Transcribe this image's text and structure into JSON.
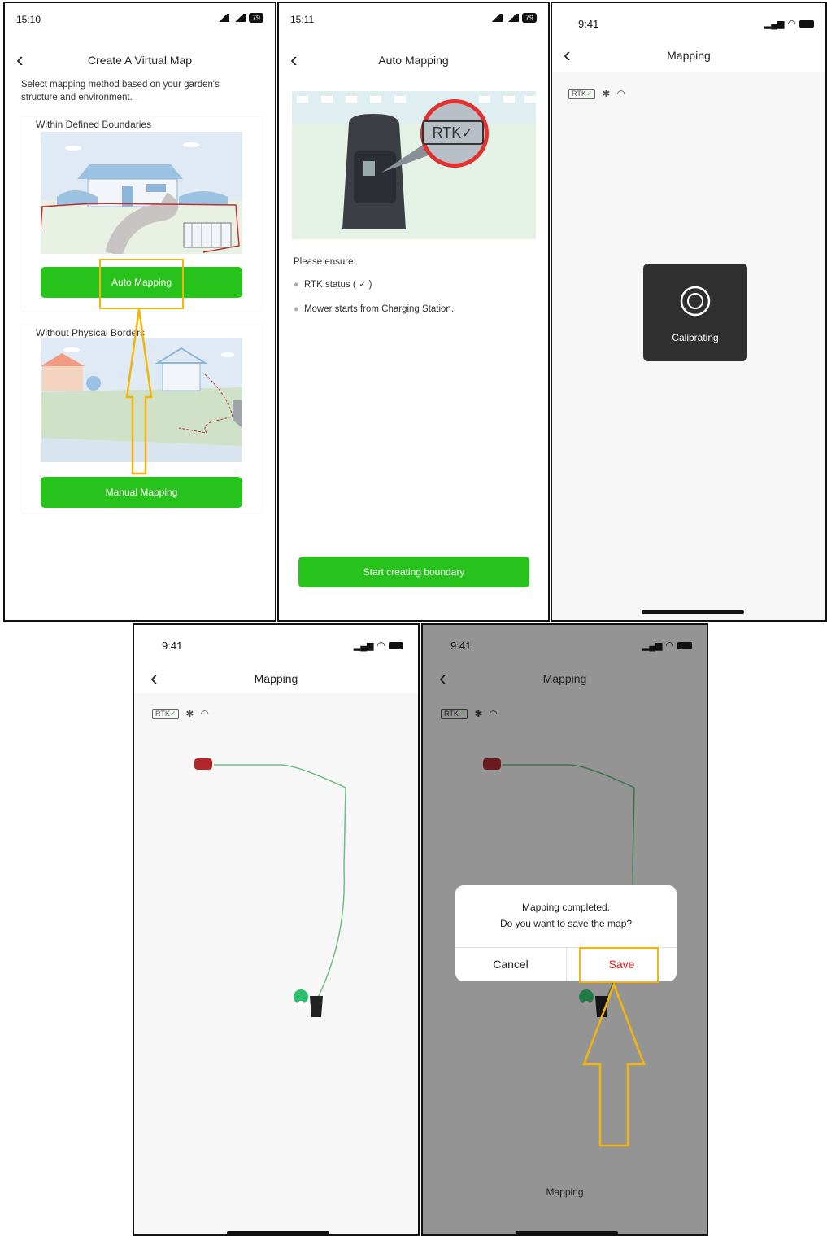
{
  "screen1": {
    "time": "15:10",
    "battery": "79",
    "title": "Create A Virtual Map",
    "description": "Select mapping method based on your garden's structure and environment.",
    "card1_title": "Within Defined Boundaries",
    "auto_button": "Auto Mapping",
    "card2_title": "Without Physical Borders",
    "manual_button": "Manual Mapping"
  },
  "screen2": {
    "time": "15:11",
    "battery": "79",
    "title": "Auto Mapping",
    "rtk_badge": "RTK✓",
    "ensure_heading": "Please ensure:",
    "bullet1": "RTK status ( ✓ )",
    "bullet2": "Mower starts from Charging Station.",
    "start_button": "Start creating boundary"
  },
  "screen3": {
    "time": "9:41",
    "title": "Mapping",
    "rtk_label": "RTK",
    "calibrating": "Calibrating"
  },
  "screen4": {
    "time": "9:41",
    "title": "Mapping",
    "rtk_label": "RTK"
  },
  "screen5": {
    "time": "9:41",
    "title": "Mapping",
    "rtk_label": "RTK",
    "dialog_line1": "Mapping completed.",
    "dialog_line2": "Do you want to save the map?",
    "cancel": "Cancel",
    "save": "Save",
    "bottom_label": "Mapping"
  },
  "colors": {
    "accent_green": "#27c21b",
    "highlight_yellow": "#f5b40a",
    "save_red": "#e21a1a",
    "mower_red": "#b3262a"
  },
  "icons": [
    "back-chevron-icon",
    "bluetooth-icon",
    "wifi-icon",
    "signal-icon",
    "battery-icon",
    "calibrate-icon",
    "mower-icon",
    "charging-station-icon",
    "location-pin-icon",
    "arrow-up-annotation"
  ]
}
